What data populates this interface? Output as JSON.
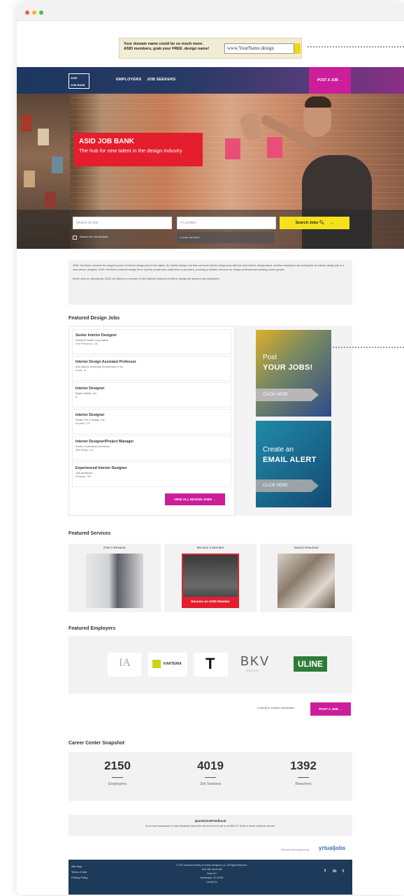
{
  "ad": {
    "text_line1": "Your domain name could be so much more.",
    "text_line2": "ASID members, grab your FREE .design name!",
    "input_value": "www.YourName.design"
  },
  "nav": {
    "logo_top": "ASID",
    "logo_bottom": "JOB BANK",
    "employers": "EMPLOYERS",
    "job_seekers": "JOB SEEKERS",
    "post_job": "POST A JOB"
  },
  "hero": {
    "title": "ASID JOB BANK",
    "subtitle": "The hub for new talent in the design industry"
  },
  "search": {
    "keyword_placeholder": "Search by title",
    "location_placeholder": "Location",
    "button": "Search Jobs",
    "remote_label": "Search for remote jobs",
    "alert_placeholder": "Create Job Alert"
  },
  "intro": {
    "p1": "ASID Job Bank connects the largest source of interior design jobs in the nation. An interior design hub that connects interior design jobs with the best interior design talent, whether employers are looking for an interior design job or a new interior designer. ASID Job Bank connects design firms and the people who make them successful, providing a reliable resource for design professionals seeking career growth.",
    "p2": "Never miss an opportunity. ASID Job Bank is a member of the National Network of interior design job seekers and employers."
  },
  "featured_jobs": {
    "title": "Featured Design Jobs",
    "jobs": [
      {
        "title": "Senior Interior Designer",
        "company": "Stanford Health Corporation",
        "location": "San Francisco, CA"
      },
      {
        "title": "Interior Design Assistant Professor",
        "company": "Bob Adams University Architecture & Inc.",
        "location": "Ames, IA"
      },
      {
        "title": "Interior Designer",
        "company": "Baylor Halder, Inc.",
        "location": "IL"
      },
      {
        "title": "Interior Designer",
        "company": "Studio The 4 Design, Inc.",
        "location": "Boulder, CO"
      },
      {
        "title": "Interior Designer/Project Manager",
        "company": "Studio Consortium Architects",
        "location": "San Diego, CA"
      },
      {
        "title": "Experienced Interior Designer",
        "company": "JSA Architects",
        "location": "Portland, OR"
      }
    ],
    "view_all": "VIEW ALL DESIGN JOBS"
  },
  "promos": {
    "post_line1": "Post",
    "post_line2": "YOUR JOBS!",
    "post_button": "CLICK HERE",
    "alert_line1": "Create an",
    "alert_line2": "EMAIL ALERT",
    "alert_button": "CLICK HERE"
  },
  "services": {
    "title": "Featured Services",
    "items": [
      {
        "label": "Post A Resume"
      },
      {
        "label": "Become a Member",
        "overlay": "Become an ASID Member"
      },
      {
        "label": "Search Resumes"
      }
    ]
  },
  "employers": {
    "title": "Featured Employers",
    "logos": [
      "IA",
      "KARTERIA",
      "T",
      "BKV",
      "ULINE"
    ],
    "bkv_sub": "GROUP"
  },
  "post_cta": {
    "text": "Looking to expand candidates",
    "button": "POST A JOB"
  },
  "snapshot": {
    "title": "Career Center Snapshot",
    "stats": [
      {
        "value": "2150",
        "label": "Employers"
      },
      {
        "value": "4019",
        "label": "Job Seekers"
      },
      {
        "value": "1392",
        "label": "Resumes"
      }
    ]
  },
  "feedback": {
    "title": "Questions/Feedback",
    "text": "If you need assistance or have feedback about the site feel free to call us at 888-277-5155 or email customer service."
  },
  "powered": {
    "text": "Site built and powered by",
    "brand": "yrtualjobs"
  },
  "footer": {
    "links": [
      "Site Map",
      "Terms of Use",
      "Privacy Policy"
    ],
    "copy_lines": [
      "© 2017 American Society of Interior Designers, Inc. All Rights Reserved.",
      "1152 15th Street NW",
      "Suite 910",
      "Washington, DC 20005",
      "Contact Us"
    ],
    "social": [
      "f",
      "in",
      "t"
    ]
  },
  "colors": {
    "nav_start": "#1c3760",
    "nav_end": "#8a2f86",
    "magenta": "#cc1d9a",
    "hero_red": "#e41e2c",
    "search_yellow": "#f3e21c",
    "footer_navy": "#1d3a5a"
  }
}
